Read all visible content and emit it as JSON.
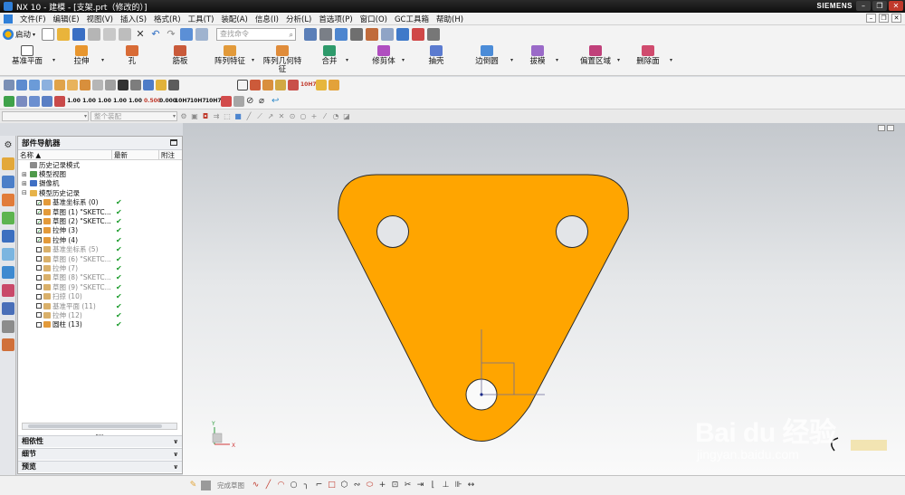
{
  "window": {
    "title": "NX 10 - 建模 - [支架.prt（修改的）]",
    "brand": "SIEMENS"
  },
  "menubar": {
    "items": [
      "文件(F)",
      "编辑(E)",
      "视图(V)",
      "插入(S)",
      "格式(R)",
      "工具(T)",
      "装配(A)",
      "信息(I)",
      "分析(L)",
      "首选项(P)",
      "窗口(O)",
      "GC工具箱",
      "帮助(H)"
    ]
  },
  "toolbar1": {
    "start_label": "启动",
    "search_placeholder": "查找命令"
  },
  "ribbon": {
    "items": [
      "基准平面",
      "拉伸",
      "孔",
      "筋板",
      "阵列特征",
      "阵列几何特",
      "征",
      "合并",
      "修剪体",
      "抽壳",
      "边倒圆",
      "拔模",
      "偏置区域",
      "删除面"
    ]
  },
  "toolbar3": {
    "numeric_icons": [
      "1.00",
      "1.00",
      "1.00",
      "1.00",
      "1.00",
      "0.500",
      "0.000",
      "10H7",
      "10H7",
      "10H7"
    ]
  },
  "selbar": {
    "filter_placeholder": "",
    "scope_placeholder": "整个装配"
  },
  "navigator": {
    "title": "部件导航器",
    "columns": {
      "name": "名称",
      "latest": "最新",
      "note": "附注"
    },
    "rows": [
      {
        "label": "历史记录模式",
        "indent": 0,
        "check": false,
        "tick": false,
        "grey": false
      },
      {
        "label": "模型视图",
        "indent": 0,
        "check": false,
        "tick": false,
        "grey": false
      },
      {
        "label": "摄像机",
        "indent": 0,
        "check": false,
        "tick": false,
        "grey": false
      },
      {
        "label": "模型历史记录",
        "indent": 0,
        "check": false,
        "tick": false,
        "grey": false
      },
      {
        "label": "基准坐标系 (0)",
        "indent": 1,
        "check": true,
        "tick": true,
        "grey": false
      },
      {
        "label": "草图 (1) \"SKETC...",
        "indent": 1,
        "check": true,
        "tick": true,
        "grey": false
      },
      {
        "label": "草图 (2) \"SKETC...",
        "indent": 1,
        "check": true,
        "tick": true,
        "grey": false
      },
      {
        "label": "拉伸 (3)",
        "indent": 1,
        "check": true,
        "tick": true,
        "grey": false
      },
      {
        "label": "拉伸 (4)",
        "indent": 1,
        "check": true,
        "tick": true,
        "grey": false
      },
      {
        "label": "基准坐标系 (5)",
        "indent": 1,
        "check": false,
        "tick": true,
        "grey": true
      },
      {
        "label": "草图 (6) \"SKETC...",
        "indent": 1,
        "check": false,
        "tick": true,
        "grey": true
      },
      {
        "label": "拉伸 (7)",
        "indent": 1,
        "check": false,
        "tick": true,
        "grey": true
      },
      {
        "label": "草图 (8) \"SKETC...",
        "indent": 1,
        "check": false,
        "tick": true,
        "grey": true
      },
      {
        "label": "草图 (9) \"SKETC...",
        "indent": 1,
        "check": false,
        "tick": true,
        "grey": true
      },
      {
        "label": "扫掠 (10)",
        "indent": 1,
        "check": false,
        "tick": true,
        "grey": true
      },
      {
        "label": "基准平面 (11)",
        "indent": 1,
        "check": false,
        "tick": true,
        "grey": true
      },
      {
        "label": "拉伸 (12)",
        "indent": 1,
        "check": false,
        "tick": true,
        "grey": true
      },
      {
        "label": "圆柱 (13)",
        "indent": 1,
        "check": false,
        "tick": true,
        "grey": false
      }
    ],
    "panels": [
      "相依性",
      "细节",
      "预览"
    ]
  },
  "viewport": {
    "part_color": "#FFA500",
    "triad_labels": {
      "x": "X",
      "y": "Y"
    }
  },
  "watermark": {
    "main": "Bai du 经验",
    "sub": "jingyan.baidu.com"
  },
  "statusbar": {
    "filter_text": "完成草图"
  }
}
